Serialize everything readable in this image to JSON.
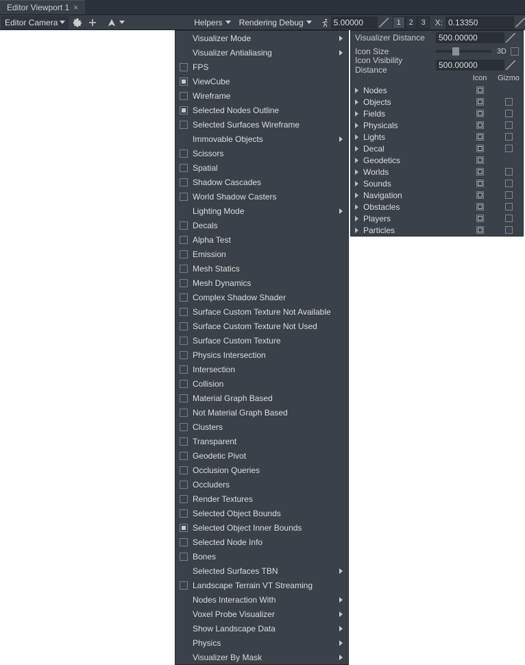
{
  "tab_title": "Editor Viewport 1",
  "toolbar": {
    "camera_select": "Editor Camera",
    "helpers_label": "Helpers",
    "render_label": "Rendering Debug",
    "speed_value": "5.00000",
    "view_buttons": [
      "1",
      "2",
      "3"
    ],
    "x_label": "X:",
    "x_value": "0.13350"
  },
  "menu_items": [
    {
      "label": "Visualizer Mode",
      "cb": null,
      "sub": true
    },
    {
      "label": "Visualizer Antialiasing",
      "cb": null,
      "sub": true
    },
    {
      "label": "FPS",
      "cb": false,
      "sub": false
    },
    {
      "label": "ViewCube",
      "cb": true,
      "sub": false
    },
    {
      "label": "Wireframe",
      "cb": false,
      "sub": false
    },
    {
      "label": "Selected Nodes Outline",
      "cb": true,
      "sub": false
    },
    {
      "label": "Selected Surfaces Wireframe",
      "cb": false,
      "sub": false
    },
    {
      "label": "Immovable Objects",
      "cb": null,
      "sub": true
    },
    {
      "label": "Scissors",
      "cb": false,
      "sub": false
    },
    {
      "label": "Spatial",
      "cb": false,
      "sub": false
    },
    {
      "label": "Shadow Cascades",
      "cb": false,
      "sub": false
    },
    {
      "label": "World Shadow Casters",
      "cb": false,
      "sub": false
    },
    {
      "label": "Lighting Mode",
      "cb": null,
      "sub": true
    },
    {
      "label": "Decals",
      "cb": false,
      "sub": false
    },
    {
      "label": "Alpha Test",
      "cb": false,
      "sub": false
    },
    {
      "label": "Emission",
      "cb": false,
      "sub": false
    },
    {
      "label": "Mesh Statics",
      "cb": false,
      "sub": false
    },
    {
      "label": "Mesh Dynamics",
      "cb": false,
      "sub": false
    },
    {
      "label": "Complex Shadow Shader",
      "cb": false,
      "sub": false
    },
    {
      "label": "Surface Custom Texture Not Available",
      "cb": false,
      "sub": false
    },
    {
      "label": "Surface Custom Texture Not Used",
      "cb": false,
      "sub": false
    },
    {
      "label": "Surface Custom Texture",
      "cb": false,
      "sub": false
    },
    {
      "label": "Physics Intersection",
      "cb": false,
      "sub": false
    },
    {
      "label": "Intersection",
      "cb": false,
      "sub": false
    },
    {
      "label": "Collision",
      "cb": false,
      "sub": false
    },
    {
      "label": "Material Graph Based",
      "cb": false,
      "sub": false
    },
    {
      "label": "Not Material Graph Based",
      "cb": false,
      "sub": false
    },
    {
      "label": "Clusters",
      "cb": false,
      "sub": false
    },
    {
      "label": "Transparent",
      "cb": false,
      "sub": false
    },
    {
      "label": "Geodetic Pivot",
      "cb": false,
      "sub": false
    },
    {
      "label": "Occlusion Queries",
      "cb": false,
      "sub": false
    },
    {
      "label": "Occluders",
      "cb": false,
      "sub": false
    },
    {
      "label": "Render Textures",
      "cb": false,
      "sub": false
    },
    {
      "label": "Selected Object Bounds",
      "cb": false,
      "sub": false
    },
    {
      "label": "Selected Object Inner Bounds",
      "cb": true,
      "sub": false
    },
    {
      "label": "Selected Node Info",
      "cb": false,
      "sub": false
    },
    {
      "label": "Bones",
      "cb": false,
      "sub": false
    },
    {
      "label": "Selected Surfaces TBN",
      "cb": null,
      "sub": true
    },
    {
      "label": "Landscape Terrain VT Streaming",
      "cb": false,
      "sub": false
    },
    {
      "label": "Nodes Interaction With",
      "cb": null,
      "sub": true
    },
    {
      "label": "Voxel Probe Visualizer",
      "cb": null,
      "sub": true
    },
    {
      "label": "Show Landscape Data",
      "cb": null,
      "sub": true
    },
    {
      "label": "Physics",
      "cb": null,
      "sub": true
    },
    {
      "label": "Visualizer By Mask",
      "cb": null,
      "sub": true
    }
  ],
  "right_panel": {
    "vis_dist_label": "Visualizer Distance",
    "vis_dist_value": "500.00000",
    "icon_size_label": "Icon Size",
    "three_d_label": "3D",
    "icon_vis_label": "Icon Visibility Distance",
    "icon_vis_value": "500.00000",
    "header_icon": "Icon",
    "header_gizmo": "Gizmo",
    "tree": [
      {
        "label": "Nodes",
        "icon": true,
        "gizmo": null
      },
      {
        "label": "Objects",
        "icon": true,
        "gizmo": false
      },
      {
        "label": "Fields",
        "icon": true,
        "gizmo": false
      },
      {
        "label": "Physicals",
        "icon": true,
        "gizmo": false
      },
      {
        "label": "Lights",
        "icon": true,
        "gizmo": false
      },
      {
        "label": "Decal",
        "icon": true,
        "gizmo": false
      },
      {
        "label": "Geodetics",
        "icon": true,
        "gizmo": null
      },
      {
        "label": "Worlds",
        "icon": true,
        "gizmo": false
      },
      {
        "label": "Sounds",
        "icon": true,
        "gizmo": false
      },
      {
        "label": "Navigation",
        "icon": true,
        "gizmo": false
      },
      {
        "label": "Obstacles",
        "icon": true,
        "gizmo": false
      },
      {
        "label": "Players",
        "icon": true,
        "gizmo": false
      },
      {
        "label": "Particles",
        "icon": true,
        "gizmo": false
      }
    ]
  }
}
